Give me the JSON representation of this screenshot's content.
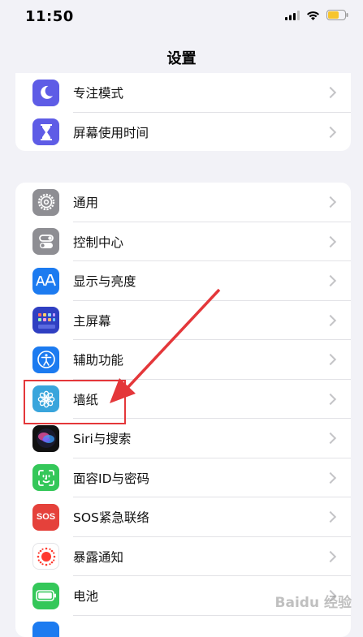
{
  "status_bar": {
    "time": "11:50"
  },
  "nav": {
    "title": "设置"
  },
  "group1": [
    {
      "label": "专注模式",
      "icon": "moon-icon",
      "color": "#5e5ce6"
    },
    {
      "label": "屏幕使用时间",
      "icon": "hourglass-icon",
      "color": "#5e5ce6"
    }
  ],
  "group2": [
    {
      "label": "通用",
      "icon": "gear-icon",
      "color": "#8e8e93"
    },
    {
      "label": "控制中心",
      "icon": "toggles-icon",
      "color": "#8e8e93"
    },
    {
      "label": "显示与亮度",
      "icon": "text-size-icon",
      "color": "#1c7bf0"
    },
    {
      "label": "主屏幕",
      "icon": "home-grid-icon",
      "color": "#2f3fc2"
    },
    {
      "label": "辅助功能",
      "icon": "accessibility-icon",
      "color": "#1c7bf0"
    },
    {
      "label": "墙纸",
      "icon": "flower-icon",
      "color": "#39a5dc"
    },
    {
      "label": "Siri与搜索",
      "icon": "siri-icon",
      "color": "#111111"
    },
    {
      "label": "面容ID与密码",
      "icon": "face-id-icon",
      "color": "#34c759"
    },
    {
      "label": "SOS紧急联络",
      "icon": "sos-icon",
      "color": "#e5413b",
      "text": "SOS"
    },
    {
      "label": "暴露通知",
      "icon": "exposure-icon",
      "color": "#ffffff"
    },
    {
      "label": "电池",
      "icon": "battery-icon",
      "color": "#34c759"
    }
  ],
  "watermark": "Baidu 经验"
}
